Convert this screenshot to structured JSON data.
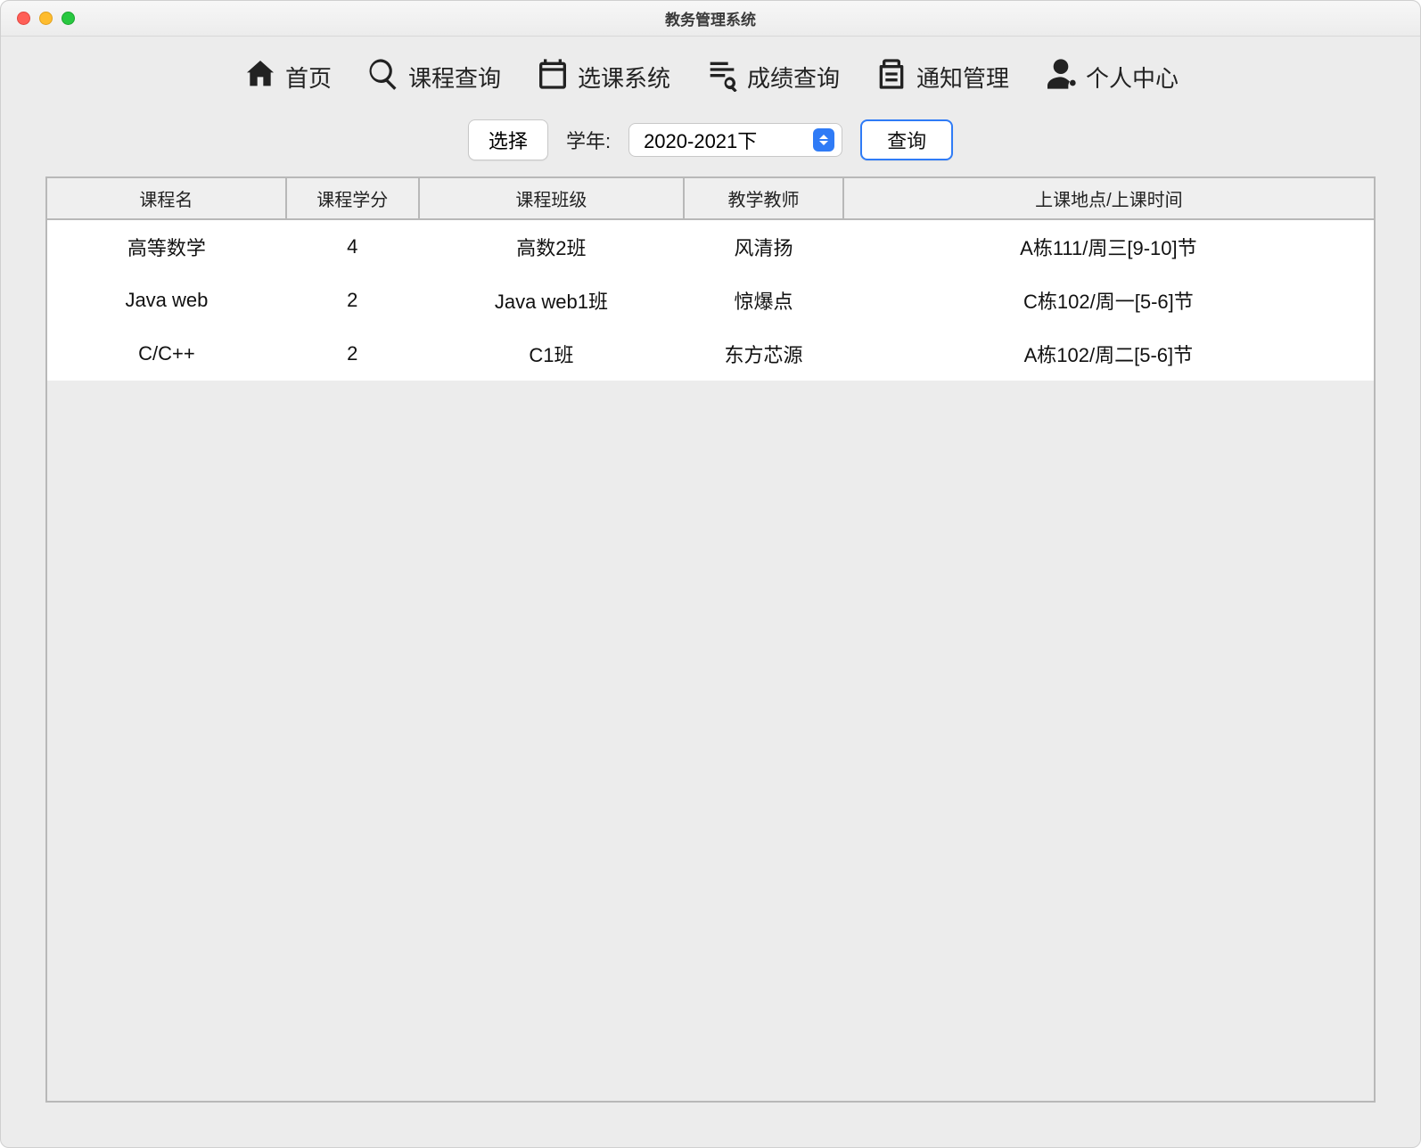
{
  "window": {
    "title": "教务管理系统"
  },
  "toolbar": {
    "home": "首页",
    "course_query": "课程查询",
    "course_select": "选课系统",
    "grade_query": "成绩查询",
    "notice_mgmt": "通知管理",
    "personal": "个人中心"
  },
  "filter": {
    "choose_btn": "选择",
    "year_label": "学年:",
    "year_selected": "2020-2021下",
    "query_btn": "查询"
  },
  "table": {
    "headers": {
      "name": "课程名",
      "credit": "课程学分",
      "class": "课程班级",
      "teacher": "教学教师",
      "place_time": "上课地点/上课时间"
    },
    "rows": [
      {
        "name": "高等数学",
        "credit": "4",
        "class": "高数2班",
        "teacher": "风清扬",
        "place_time": "A栋111/周三[9-10]节"
      },
      {
        "name": "Java web",
        "credit": "2",
        "class": "Java web1班",
        "teacher": "惊爆点",
        "place_time": "C栋102/周一[5-6]节"
      },
      {
        "name": "C/C++",
        "credit": "2",
        "class": "C1班",
        "teacher": "东方芯源",
        "place_time": "A栋102/周二[5-6]节"
      }
    ]
  }
}
